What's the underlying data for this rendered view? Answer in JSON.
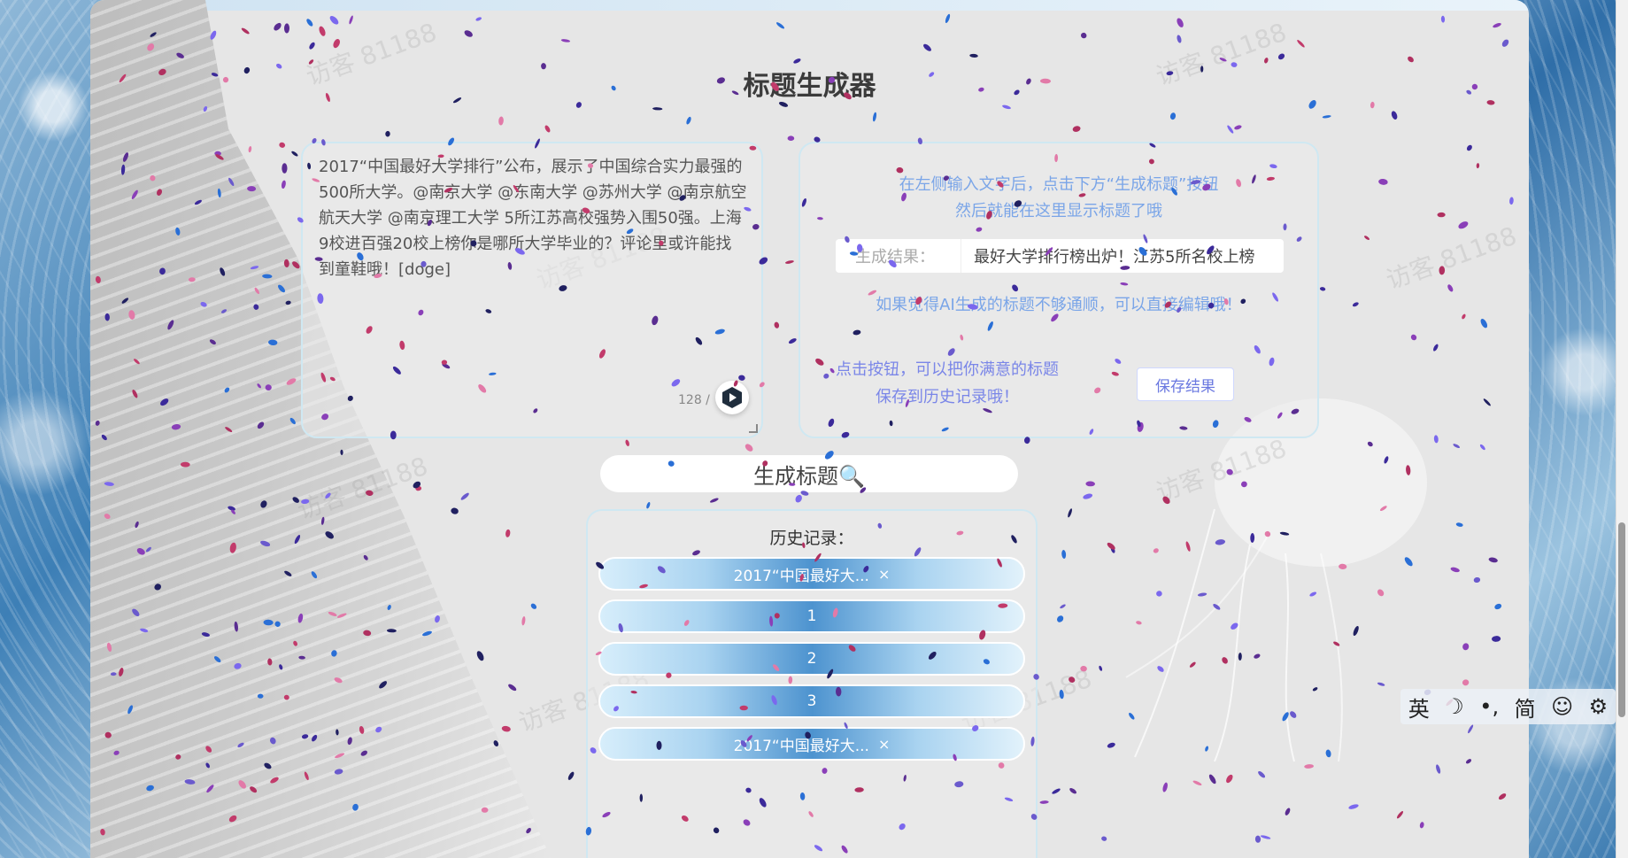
{
  "title": "标题生成器",
  "input": {
    "text": "2017“中国最好大学排行”公布，展示了中国综合实力最强的500所大学。@南京大学 @东南大学 @苏州大学 @南京航空航天大学 @南京理工大学 5所江苏高校强势入围50强。上海9校进百强20校上榜你是哪所大学毕业的？评论里或许能找到童鞋哦！[doge]",
    "counter": "128 /"
  },
  "result": {
    "hint_line1": "在左侧输入文字后，点击下方“生成标题”按钮",
    "hint_line2": "然后就能在这里显示标题了哦",
    "label": "生成结果：",
    "value": "最好大学排行榜出炉！江苏5所名校上榜",
    "edit_hint": "如果觉得AI生成的标题不够通顺，可以直接编辑哦！",
    "save_hint": "点击按钮，可以把你满意的标题保存到历史记录哦！",
    "save_button": "保存结果"
  },
  "generate_button": "生成标题🔍",
  "history": {
    "title": "历史记录：",
    "items": [
      {
        "label": "2017“中国最好大...",
        "delete": "×"
      },
      {
        "label": "1",
        "delete": ""
      },
      {
        "label": "2",
        "delete": ""
      },
      {
        "label": "3",
        "delete": ""
      },
      {
        "label": "2017“中国最好大...",
        "delete": "×"
      }
    ]
  },
  "watermark": "访客 81188",
  "ime": {
    "lang": "英",
    "moon": "☽",
    "punct": "•,",
    "simplified": "简",
    "emoji": "☺",
    "settings": "⚙"
  }
}
